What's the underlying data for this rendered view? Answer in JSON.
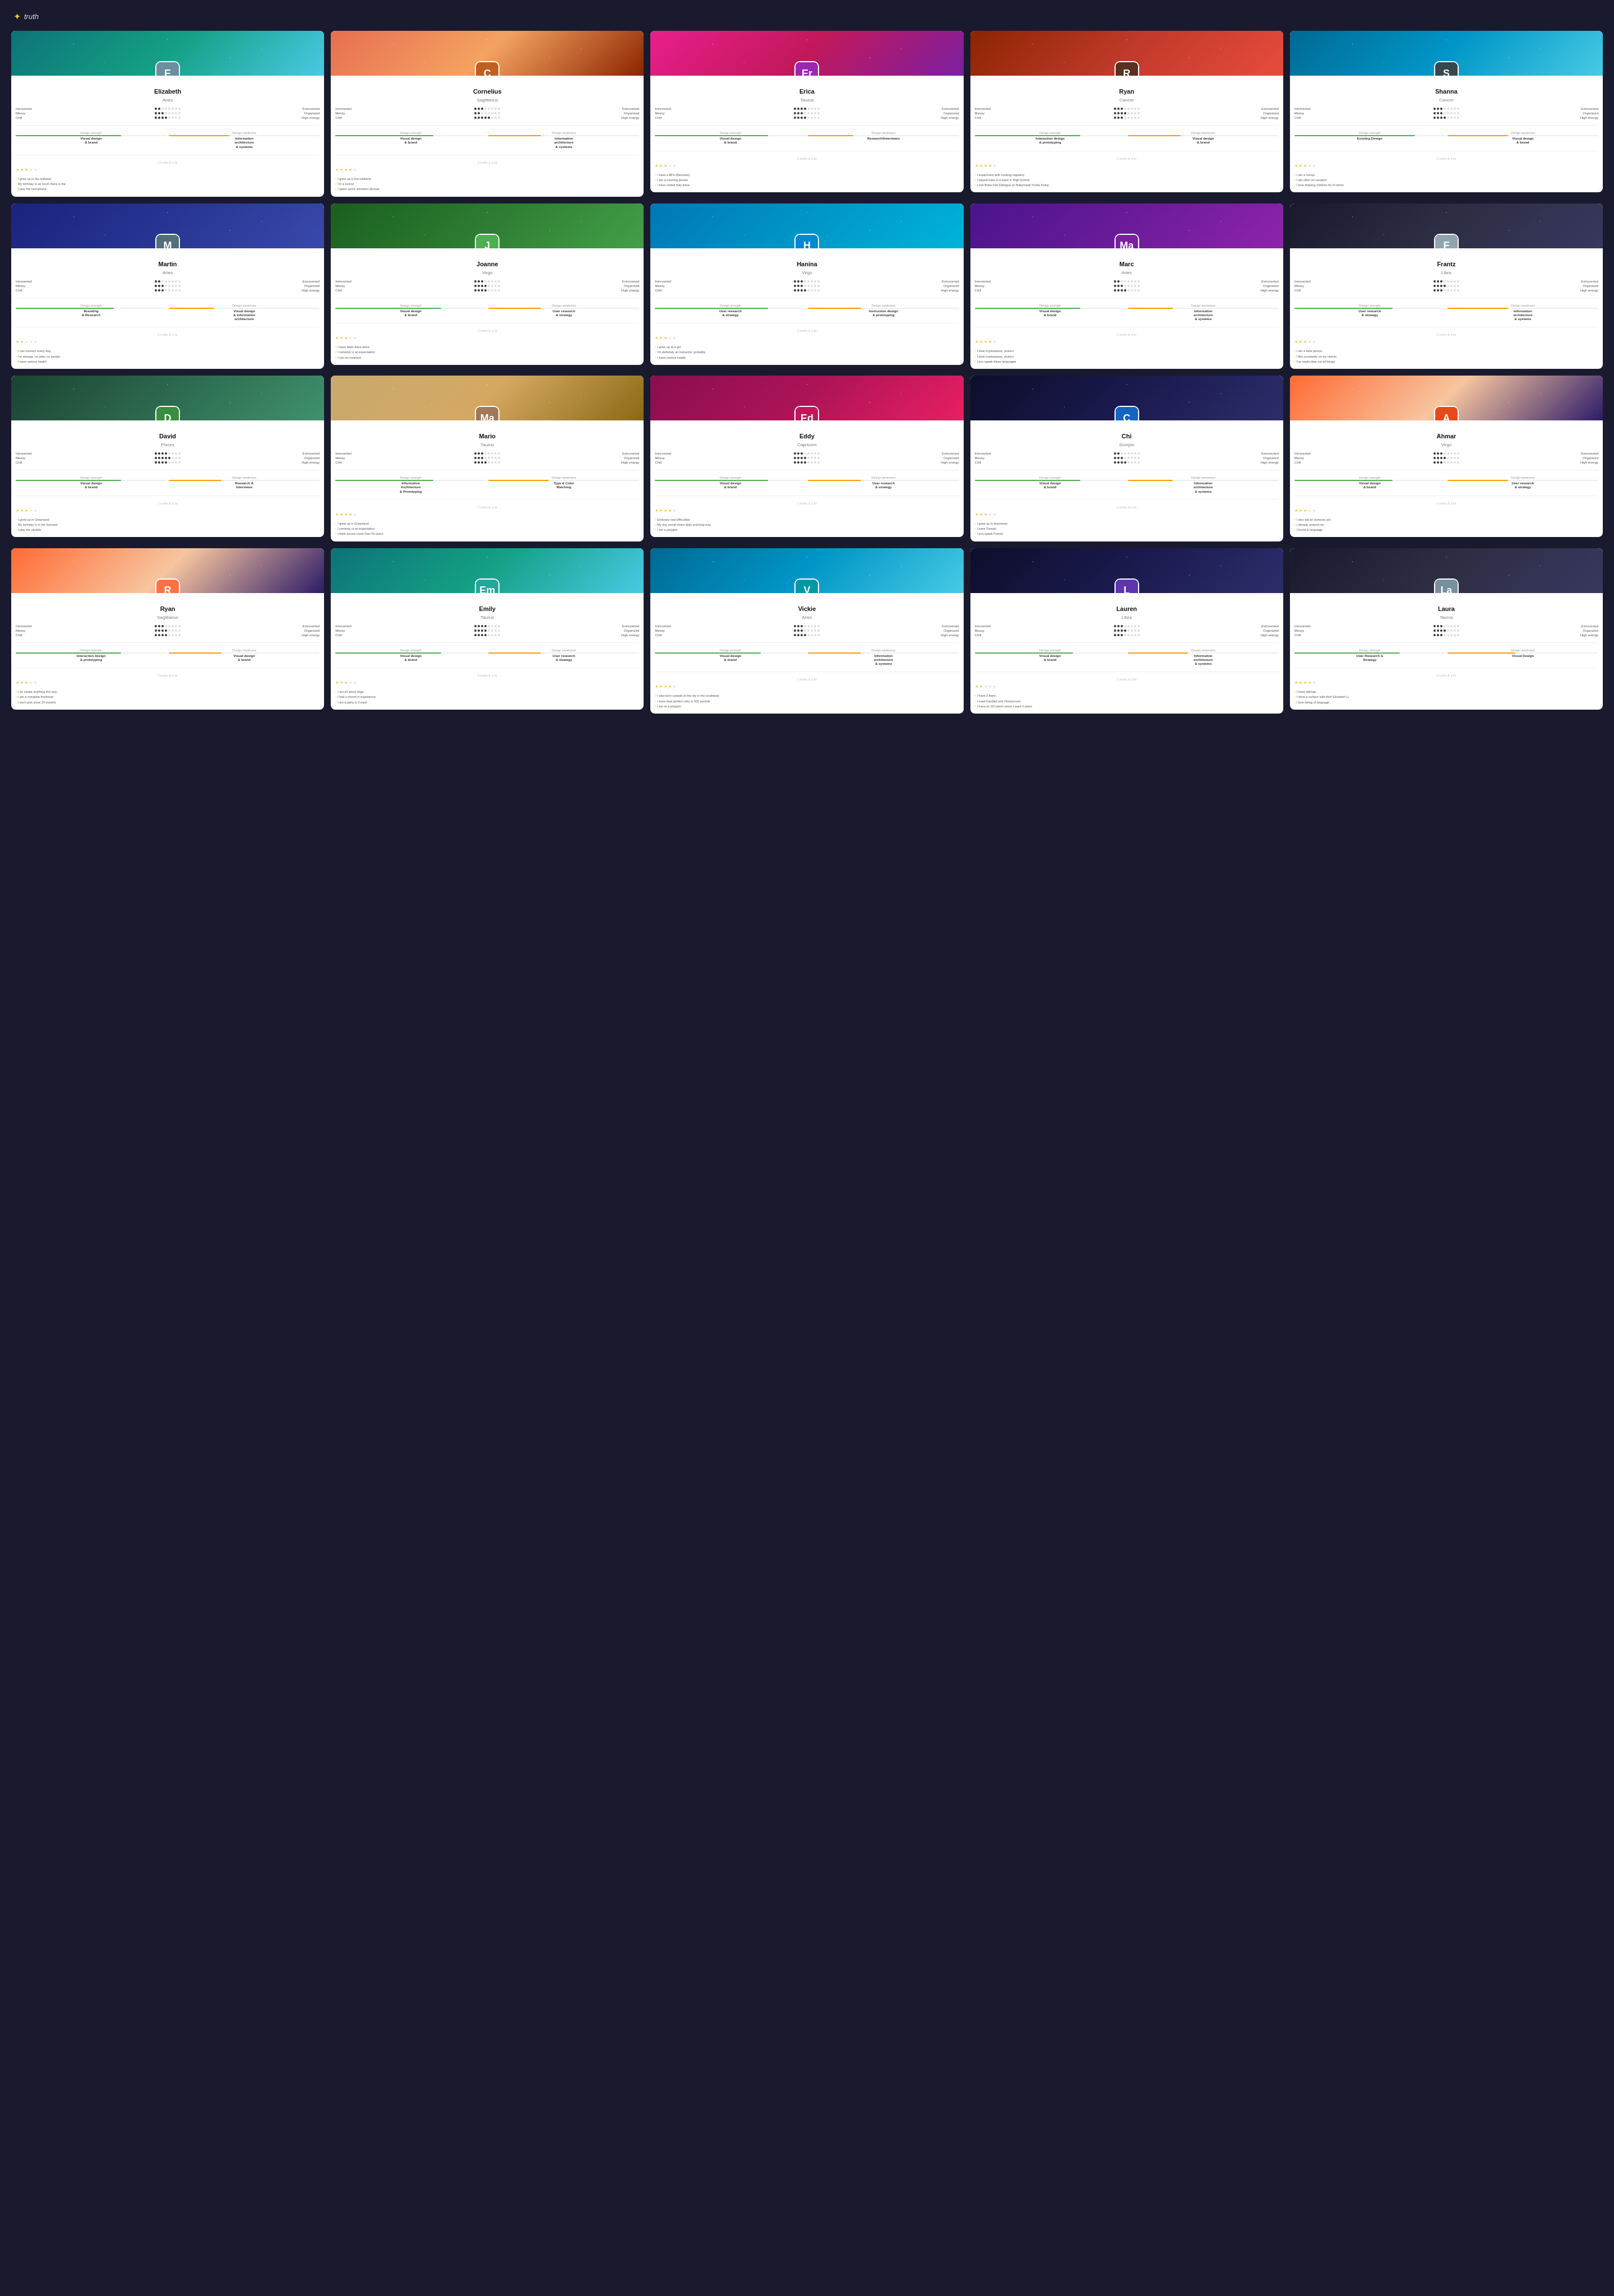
{
  "logo": {
    "star": "✦",
    "text": "truth"
  },
  "rows": [
    {
      "cards": [
        {
          "id": "elizabeth",
          "name": "Elizabeth",
          "sign": "Aries",
          "banner": "banner-teal",
          "avatar_initial": "E",
          "avatar_color": "#6a8fa0",
          "stats": {
            "introverted": 2,
            "messy": 3,
            "chill": 4,
            "extroverted_label": "Extroverted",
            "organized_label": "Organized",
            "high_energy_label": "High Energy"
          },
          "skills": [
            {
              "label": "Design strength",
              "name": "Visual design\n& brand",
              "fill": 70
            },
            {
              "label": "Design weakness",
              "name": "Information\narchitecture\n& systems",
              "fill": 40
            }
          ],
          "section": "2 truths & a lie",
          "stars": 3,
          "quotes": [
            "I grew up in the midwest",
            "My birthday is as much there is the",
            "I play the saxophone"
          ]
        },
        {
          "id": "cornelius",
          "name": "Cornelius",
          "sign": "Sagittarius",
          "banner": "banner-orange",
          "avatar_initial": "C",
          "avatar_color": "#c06020",
          "stats": {
            "introverted": 3,
            "messy": 2,
            "chill": 5
          },
          "skills": [
            {
              "label": "Design strength",
              "name": "Visual design\n& brand",
              "fill": 65
            },
            {
              "label": "Design weakness",
              "name": "Information\narchitecture\n& systems",
              "fill": 35
            }
          ],
          "section": "2 truths & a lie",
          "stars": 4,
          "quotes": [
            "I grew up in the midwest",
            "I'm a runner",
            "I spent some summers abroad"
          ]
        },
        {
          "id": "erica",
          "name": "Erica",
          "sign": "Taurus",
          "banner": "banner-pink",
          "avatar_initial": "Er",
          "avatar_color": "#9c27b0",
          "stats": {
            "introverted": 4,
            "messy": 3,
            "chill": 4
          },
          "skills": [
            {
              "label": "Design strength",
              "name": "Visual design\n& brand",
              "fill": 75
            },
            {
              "label": "Design weakness",
              "name": "Research/Interviews",
              "fill": 30
            }
          ],
          "section": "2 truths & a lie",
          "stars": 3,
          "quotes": [
            "I have a BFA (Bachelor)",
            "I am a morning person",
            "I have visited Italy twice"
          ]
        },
        {
          "id": "ryan-cancer",
          "name": "Ryan",
          "sign": "Cancer",
          "banner": "banner-red",
          "avatar_initial": "R",
          "avatar_color": "#5a3020",
          "stats": {
            "introverted": 3,
            "messy": 4,
            "chill": 3
          },
          "skills": [
            {
              "label": "Design strength",
              "name": "Interaction design\n& prototyping",
              "fill": 70
            },
            {
              "label": "Design weakness",
              "name": "Visual design\n& brand",
              "fill": 35
            }
          ],
          "section": "2 truths & a lie",
          "stars": 4,
          "quotes": [
            "I experiment with cooking regularly",
            "I played bass in a band in High School",
            "I met Boba Fett Dialogue on Babymetal Yuriko Kotop"
          ],
          "highlight": true
        },
        {
          "id": "shanna",
          "name": "Shanna",
          "sign": "Cancer",
          "banner": "banner-cyan",
          "avatar_initial": "S",
          "avatar_color": "#37474f",
          "stats": {
            "introverted": 3,
            "messy": 3,
            "chill": 4
          },
          "skills": [
            {
              "label": "Design strength",
              "name": "Existing Design",
              "fill": 80
            },
            {
              "label": "Design weakness",
              "name": "Visual design\n& brand",
              "fill": 40
            }
          ],
          "section": "2 truths & a lie",
          "stars": 3,
          "quotes": [
            "I am a runner",
            "I am often on vacation",
            "I love drawing children for AI terms"
          ]
        }
      ]
    },
    {
      "cards": [
        {
          "id": "martin",
          "name": "Martin",
          "sign": "Aries",
          "banner": "banner-blue",
          "avatar_initial": "M",
          "avatar_color": "#546e7a",
          "stats": {
            "introverted": 2,
            "messy": 3,
            "chill": 3
          },
          "skills": [
            {
              "label": "Design strength",
              "name": "Branding\n& Research",
              "fill": 65
            },
            {
              "label": "Design weakness",
              "name": "Visual design\n& information\narchitecture",
              "fill": 30
            }
          ],
          "section": "2 truths & a lie",
          "stars": 2,
          "quotes": [
            "I can connect every dog",
            "I'm strange, no pets, no people",
            "I have various health"
          ]
        },
        {
          "id": "joanne",
          "name": "Joanne",
          "sign": "Virgo",
          "banner": "banner-green",
          "avatar_initial": "J",
          "avatar_color": "#4caf50",
          "stats": {
            "introverted": 3,
            "messy": 4,
            "chill": 4
          },
          "skills": [
            {
              "label": "Design strength",
              "name": "Visual design\n& brand",
              "fill": 70
            },
            {
              "label": "Design weakness",
              "name": "User research\n& strategy",
              "fill": 35
            }
          ],
          "section": "2 truths & a lie",
          "stars": 3,
          "quotes": [
            "I have been twice done",
            "I certainly is an expectation",
            "I can an invariant"
          ]
        },
        {
          "id": "hanina",
          "name": "Hanina",
          "sign": "Virgo",
          "banner": "banner-water",
          "avatar_initial": "H",
          "avatar_color": "#0288d1",
          "stats": {
            "introverted": 3,
            "messy": 3,
            "chill": 4
          },
          "skills": [
            {
              "label": "Design strength",
              "name": "User research\n& strategy",
              "fill": 75
            },
            {
              "label": "Design weakness",
              "name": "Instruction design\n& prototyping",
              "fill": 35
            }
          ],
          "section": "2 truths & a lie",
          "stars": 3,
          "quotes": [
            "I grew up at a girl",
            "I'm definitely an instructor, probably",
            "I have various health"
          ]
        },
        {
          "id": "marc",
          "name": "Marc",
          "sign": "Aries",
          "banner": "banner-purple",
          "avatar_initial": "Ma",
          "avatar_color": "#7b1fa2",
          "stats": {
            "introverted": 2,
            "messy": 3,
            "chill": 4
          },
          "skills": [
            {
              "label": "Design strength",
              "name": "Visual design\n& brand",
              "fill": 70
            },
            {
              "label": "Design weakness",
              "name": "Information\narchitecture\n& systems",
              "fill": 30
            }
          ],
          "section": "2 truths & a lie",
          "stars": 4,
          "quotes": [
            "I deal cryptowaves, protect",
            "I deal cryptowaves, protect",
            "I you speak these languages"
          ],
          "highlight": true
        },
        {
          "id": "frantz",
          "name": "Frantz",
          "sign": "Libra",
          "banner": "banner-dark",
          "avatar_initial": "F",
          "avatar_color": "#90a4ae",
          "stats": {
            "introverted": 3,
            "messy": 4,
            "chill": 3
          },
          "skills": [
            {
              "label": "Design strength",
              "name": "User research\n& strategy",
              "fill": 65
            },
            {
              "label": "Design weakness",
              "name": "Information\narchitecture\n& systems",
              "fill": 40
            }
          ],
          "section": "2 truths & a lie",
          "stars": 3,
          "quotes": [
            "I am a data person",
            "I like constantly on my clients",
            "I've made dear cut all things"
          ]
        }
      ]
    },
    {
      "cards": [
        {
          "id": "david",
          "name": "David",
          "sign": "Pisces",
          "banner": "banner-forest",
          "avatar_initial": "D",
          "avatar_color": "#388e3c",
          "stats": {
            "introverted": 4,
            "messy": 5,
            "chill": 4
          },
          "skills": [
            {
              "label": "Design strength",
              "name": "Visual design\n& brand",
              "fill": 70
            },
            {
              "label": "Design weakness",
              "name": "Research &\nInterviews",
              "fill": 35
            }
          ],
          "section": "2 truths & a lie",
          "stars": 3,
          "quotes": [
            "I grew up in Greenland",
            "My birthday is in the Summer",
            "I play the ukulele"
          ]
        },
        {
          "id": "mario",
          "name": "Mario",
          "sign": "Taurus",
          "banner": "banner-sand",
          "avatar_initial": "Ma",
          "avatar_color": "#a0785a",
          "stats": {
            "introverted": 3,
            "messy": 3,
            "chill": 4
          },
          "skills": [
            {
              "label": "Design strength",
              "name": "Information\nArchitecture\n& Prototyping",
              "fill": 65
            },
            {
              "label": "Design weakness",
              "name": "Type & Color\nMatching",
              "fill": 40
            }
          ],
          "section": "2 truths & a lie",
          "stars": 4,
          "quotes": [
            "I grew up in Greenland",
            "I certainly is an expectation",
            "I think across more than 50 years"
          ],
          "highlight": true
        },
        {
          "id": "eddy",
          "name": "Eddy",
          "sign": "Capricorn",
          "banner": "banner-magenta",
          "avatar_initial": "Ed",
          "avatar_color": "#c2185b",
          "stats": {
            "introverted": 3,
            "messy": 4,
            "chill": 4
          },
          "skills": [
            {
              "label": "Design strength",
              "name": "Visual design\n& brand",
              "fill": 75
            },
            {
              "label": "Design weakness",
              "name": "User research\n& strategy",
              "fill": 35
            }
          ],
          "section": "2 truths & a lie",
          "stars": 4,
          "quotes": [
            "Embrace real difficulties",
            "My day would share daily and help way",
            "I am a polyglot"
          ]
        },
        {
          "id": "chi",
          "name": "Chi",
          "sign": "Scorpio",
          "banner": "banner-space",
          "avatar_initial": "C",
          "avatar_color": "#1565c0",
          "stats": {
            "introverted": 2,
            "messy": 3,
            "chill": 4
          },
          "skills": [
            {
              "label": "Design strength",
              "name": "Visual design\n& brand",
              "fill": 70
            },
            {
              "label": "Design weakness",
              "name": "Information\narchitecture\n& systems",
              "fill": 30
            }
          ],
          "section": "2 truths & a lie",
          "stars": 3,
          "quotes": [
            "I grew up in downtown",
            "I have Tomato",
            "I you speak French"
          ]
        },
        {
          "id": "ahmar",
          "name": "Ahmar",
          "sign": "Virgo",
          "banner": "banner-sunset",
          "avatar_initial": "A",
          "avatar_color": "#e64a19",
          "stats": {
            "introverted": 3,
            "messy": 4,
            "chill": 3
          },
          "skills": [
            {
              "label": "Design strength",
              "name": "Visual design\n& brand",
              "fill": 65
            },
            {
              "label": "Design weakness",
              "name": "User research\n& strategy",
              "fill": 40
            }
          ],
          "section": "2 truths & a lie",
          "stars": 3,
          "quotes": [
            "I also did an exercise am",
            "I already around me",
            "I found & language"
          ]
        }
      ]
    },
    {
      "cards": [
        {
          "id": "ryan-sagittarius",
          "name": "Ryan",
          "sign": "Sagittarius",
          "banner": "banner-sunset",
          "avatar_initial": "R",
          "avatar_color": "#ff7043",
          "stats": {
            "introverted": 3,
            "messy": 4,
            "chill": 4
          },
          "skills": [
            {
              "label": "Design strength",
              "name": "Interaction design\n& prototyping",
              "fill": 70
            },
            {
              "label": "Design weakness",
              "name": "Visual design\n& brand",
              "fill": 35
            }
          ],
          "section": "2 truths & a lie",
          "stars": 3,
          "quotes": [
            "I do create anything this way",
            "I am a complete freshman",
            "I don't pick since 24 months"
          ],
          "highlight": true
        },
        {
          "id": "emily",
          "name": "Emily",
          "sign": "Taurus",
          "banner": "banner-teal",
          "avatar_initial": "Em",
          "avatar_color": "#26a69a",
          "stats": {
            "introverted": 4,
            "messy": 4,
            "chill": 4
          },
          "skills": [
            {
              "label": "Design strength",
              "name": "Visual design\n& brand",
              "fill": 70
            },
            {
              "label": "Design weakness",
              "name": "User research\n& strategy",
              "fill": 35
            }
          ],
          "section": "2 truths & a lie",
          "stars": 3,
          "quotes": [
            "I am all about dogs",
            "I had a month in experience",
            "I am a party in 5 each"
          ]
        },
        {
          "id": "vickie",
          "name": "Vickie",
          "sign": "Aries",
          "banner": "banner-cyan",
          "avatar_initial": "V",
          "avatar_color": "#0097a7",
          "stats": {
            "introverted": 3,
            "messy": 3,
            "chill": 4
          },
          "skills": [
            {
              "label": "Design strength",
              "name": "Visual design\n& brand",
              "fill": 70
            },
            {
              "label": "Design weakness",
              "name": "Information\narchitecture\n& systems",
              "fill": 35
            }
          ],
          "section": "2 truths & a lie",
          "stars": 4,
          "quotes": [
            "I also born outside of the city in the southeast",
            "I have kept perfect calm in 500 pounds",
            "I am at a polyglot"
          ]
        },
        {
          "id": "lauren",
          "name": "Lauren",
          "sign": "Libra",
          "banner": "banner-space",
          "avatar_initial": "L",
          "avatar_color": "#5e35b1",
          "stats": {
            "introverted": 3,
            "messy": 4,
            "chill": 3
          },
          "skills": [
            {
              "label": "Design strength",
              "name": "Visual design\n& brand",
              "fill": 65
            },
            {
              "label": "Design weakness",
              "name": "Information\narchitecture\n& systems",
              "fill": 40
            }
          ],
          "section": "2 truths & a lie",
          "stars": 2,
          "quotes": [
            "I have 3 there",
            "I need handled and Honeymoon",
            "I have on 5/3 which never I want 4 years"
          ]
        },
        {
          "id": "laura",
          "name": "Laura",
          "sign": "Taurus",
          "banner": "banner-dark",
          "avatar_initial": "La",
          "avatar_color": "#78909c",
          "stats": {
            "introverted": 3,
            "messy": 4,
            "chill": 3
          },
          "skills": [
            {
              "label": "Design strength",
              "name": "User Research &\nStrategy",
              "fill": 70
            },
            {
              "label": "Design weakness",
              "name": "Visual Design",
              "fill": 45
            }
          ],
          "section": "2 truths & a lie",
          "stars": 4,
          "quotes": [
            "I have siblings",
            "I done a surface with their Elizabeth Li",
            "I love being of language"
          ]
        }
      ]
    }
  ]
}
